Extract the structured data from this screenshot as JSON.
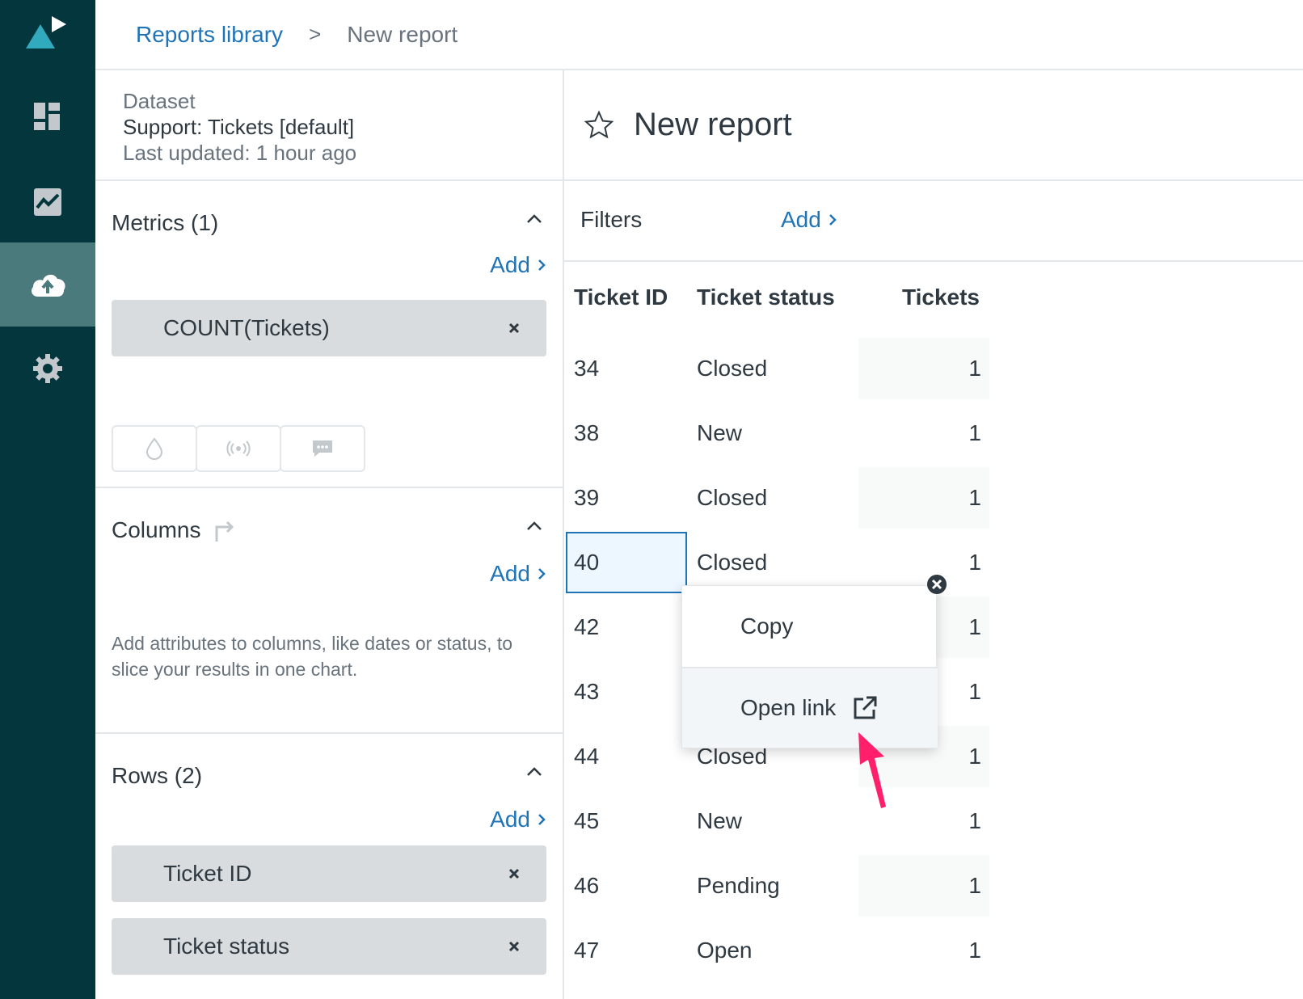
{
  "nav": {
    "items": [
      "dashboard-icon",
      "analytics-icon",
      "upload-icon",
      "settings-icon"
    ],
    "active_index": 2
  },
  "breadcrumb": {
    "link": "Reports library",
    "separator": ">",
    "current": "New report"
  },
  "dataset": {
    "label": "Dataset",
    "name": "Support: Tickets [default]",
    "updated": "Last updated: 1 hour ago"
  },
  "metrics": {
    "title": "Metrics (1)",
    "add_label": "Add",
    "items": [
      "COUNT(Tickets)"
    ]
  },
  "columns": {
    "title": "Columns",
    "add_label": "Add",
    "help": "Add attributes to columns, like dates or status, to slice your results in one chart."
  },
  "rows": {
    "title": "Rows (2)",
    "add_label": "Add",
    "items": [
      "Ticket ID",
      "Ticket status"
    ]
  },
  "report": {
    "title": "New report",
    "filters_label": "Filters",
    "filters_add": "Add"
  },
  "table": {
    "headers": [
      "Ticket ID",
      "Ticket status",
      "Tickets"
    ],
    "rows": [
      {
        "id": "34",
        "status": "Closed",
        "value": "1"
      },
      {
        "id": "38",
        "status": "New",
        "value": "1"
      },
      {
        "id": "39",
        "status": "Closed",
        "value": "1"
      },
      {
        "id": "40",
        "status": "Closed",
        "value": "1"
      },
      {
        "id": "42",
        "status": "",
        "value": "1"
      },
      {
        "id": "43",
        "status": "",
        "value": "1"
      },
      {
        "id": "44",
        "status": "Closed",
        "value": "1"
      },
      {
        "id": "45",
        "status": "New",
        "value": "1"
      },
      {
        "id": "46",
        "status": "Pending",
        "value": "1"
      },
      {
        "id": "47",
        "status": "Open",
        "value": "1"
      }
    ]
  },
  "context_menu": {
    "copy": "Copy",
    "open_link": "Open link"
  },
  "colors": {
    "nav_bg": "#03363d",
    "nav_active": "#4b7a7c",
    "link": "#1f73b7",
    "arrow": "#ff1f6b"
  }
}
